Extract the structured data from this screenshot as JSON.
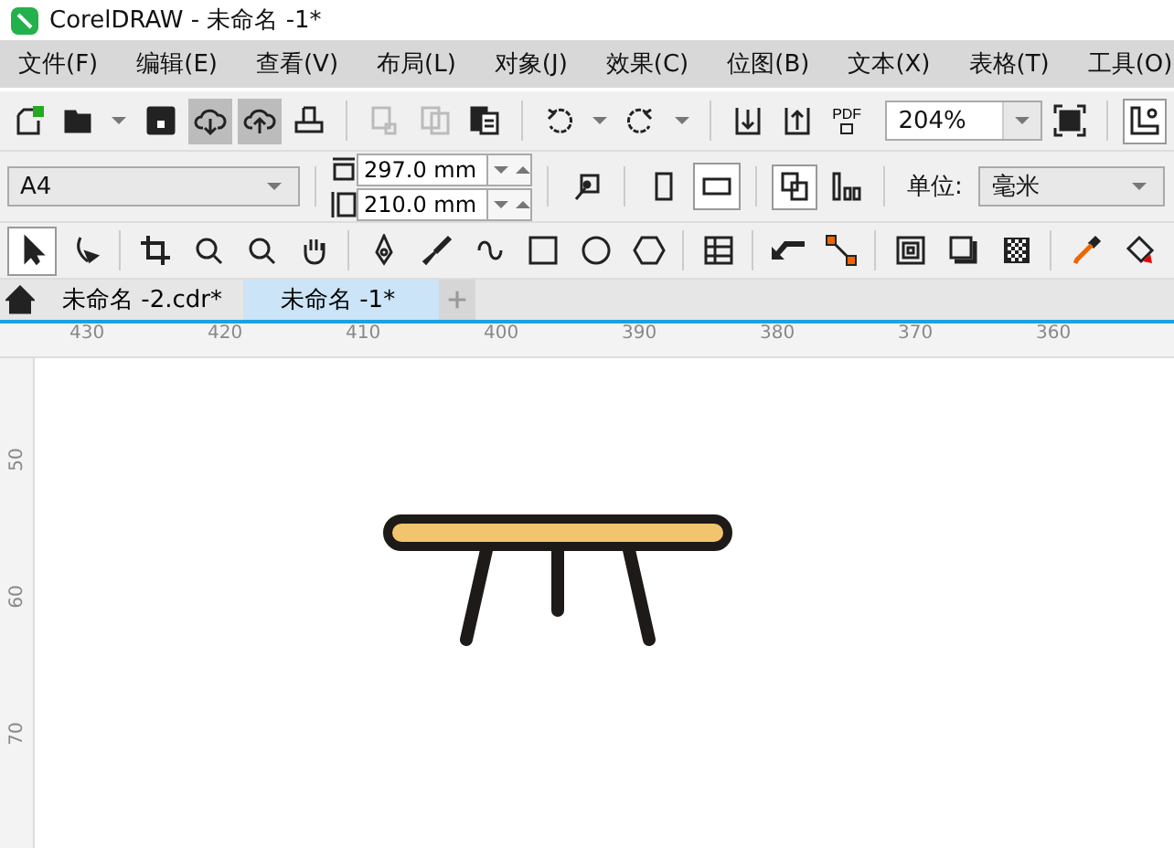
{
  "window": {
    "title": "CorelDRAW - 未命名 -1*"
  },
  "menu": [
    "文件(F)",
    "编辑(E)",
    "查看(V)",
    "布局(L)",
    "对象(J)",
    "效果(C)",
    "位图(B)",
    "文本(X)",
    "表格(T)",
    "工具(O)"
  ],
  "toolbar": [
    {
      "kind": "new",
      "pressed": false
    },
    {
      "kind": "open",
      "pressed": false
    },
    {
      "kind": "save",
      "pressed": false
    },
    {
      "kind": "cloud-down",
      "pressed": true
    },
    {
      "kind": "cloud-up",
      "pressed": true
    },
    {
      "kind": "print",
      "pressed": false
    },
    {
      "kind": "sep"
    },
    {
      "kind": "cut",
      "pressed": false
    },
    {
      "kind": "copy",
      "pressed": false
    },
    {
      "kind": "paste",
      "pressed": false
    },
    {
      "kind": "sep"
    },
    {
      "kind": "undo",
      "pressed": false
    },
    {
      "kind": "redo",
      "pressed": false
    },
    {
      "kind": "sep"
    },
    {
      "kind": "import",
      "pressed": false
    },
    {
      "kind": "export",
      "pressed": false
    },
    {
      "kind": "pdf",
      "label": "PDF",
      "pressed": false
    }
  ],
  "zoom": {
    "value": "204%"
  },
  "property_bar": {
    "page_size": "A4",
    "width": "297.0 mm",
    "height": "210.0 mm",
    "orientations": [
      {
        "kind": "portrait",
        "selected": false
      },
      {
        "kind": "landscape",
        "selected": true
      }
    ],
    "unit_label": "单位:",
    "unit": "毫米"
  },
  "tools": [
    {
      "kind": "pick",
      "selected": true
    },
    {
      "kind": "shape",
      "selected": false
    },
    {
      "kind": "sep"
    },
    {
      "kind": "crop",
      "selected": false
    },
    {
      "kind": "zoom",
      "selected": false
    },
    {
      "kind": "zoom",
      "selected": false
    },
    {
      "kind": "pan",
      "selected": false
    },
    {
      "kind": "sep"
    },
    {
      "kind": "pen",
      "selected": false
    },
    {
      "kind": "brush",
      "selected": false
    },
    {
      "kind": "curve",
      "selected": false
    },
    {
      "kind": "rect",
      "selected": false
    },
    {
      "kind": "ellipse",
      "selected": false
    },
    {
      "kind": "polygon",
      "selected": false
    },
    {
      "kind": "sep"
    },
    {
      "kind": "table",
      "selected": false
    },
    {
      "kind": "sep"
    },
    {
      "kind": "connector",
      "selected": false
    },
    {
      "kind": "dimension",
      "selected": false
    },
    {
      "kind": "sep"
    },
    {
      "kind": "contour",
      "selected": false
    },
    {
      "kind": "shadow",
      "selected": false
    },
    {
      "kind": "transparency",
      "selected": false
    },
    {
      "kind": "sep"
    },
    {
      "kind": "eyedropper",
      "selected": false
    },
    {
      "kind": "fill",
      "selected": false
    }
  ],
  "tabs": [
    {
      "label": "未命名 -2.cdr*",
      "selected": false
    },
    {
      "label": "未命名 -1*",
      "selected": true
    }
  ],
  "ruler": {
    "horizontal": [
      "430",
      "420",
      "410",
      "400",
      "390",
      "380",
      "370",
      "360"
    ],
    "vertical": [
      "50",
      "60",
      "70"
    ]
  }
}
